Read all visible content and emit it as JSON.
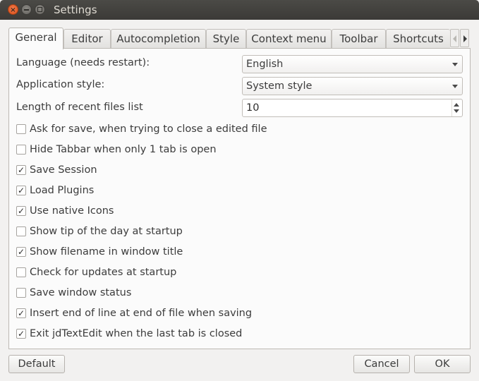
{
  "window": {
    "title": "Settings"
  },
  "tabs": [
    {
      "label": "General",
      "active": true
    },
    {
      "label": "Editor"
    },
    {
      "label": "Autocompletion"
    },
    {
      "label": "Style"
    },
    {
      "label": "Context menu"
    },
    {
      "label": "Toolbar"
    },
    {
      "label": "Shortcuts"
    }
  ],
  "general": {
    "language": {
      "label": "Language (needs restart):",
      "value": "English"
    },
    "app_style": {
      "label": "Application style:",
      "value": "System style"
    },
    "recent_files": {
      "label": "Length of recent files list",
      "value": "10"
    },
    "checkboxes": [
      {
        "label": "Ask for save, when trying to close a edited file",
        "checked": false,
        "mark": ""
      },
      {
        "label": "Hide Tabbar when only 1 tab is open",
        "checked": false,
        "mark": ""
      },
      {
        "label": "Save Session",
        "checked": true,
        "mark": "✓"
      },
      {
        "label": "Load Plugins",
        "checked": true,
        "mark": "✓"
      },
      {
        "label": "Use native Icons",
        "checked": true,
        "mark": "✓"
      },
      {
        "label": "Show tip of the day at startup",
        "checked": false,
        "mark": ""
      },
      {
        "label": "Show filename in window title",
        "checked": true,
        "mark": "✓"
      },
      {
        "label": "Check for updates at startup",
        "checked": false,
        "mark": ""
      },
      {
        "label": "Save window status",
        "checked": false,
        "mark": ""
      },
      {
        "label": "Insert end of line at end of file when saving",
        "checked": true,
        "mark": "✓"
      },
      {
        "label": "Exit jdTextEdit when the last tab is closed",
        "checked": true,
        "mark": "✓"
      }
    ]
  },
  "buttons": {
    "default": "Default",
    "cancel": "Cancel",
    "ok": "OK"
  }
}
